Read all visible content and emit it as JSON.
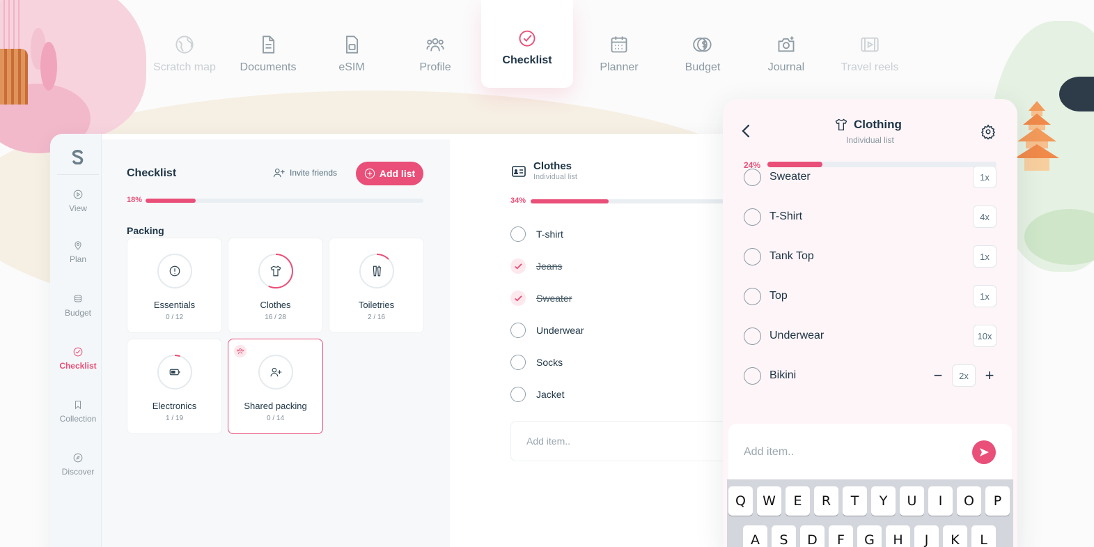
{
  "nav": {
    "tabs": [
      {
        "label": "Scratch map",
        "icon": "globe-icon",
        "state": "faded"
      },
      {
        "label": "Documents",
        "icon": "document-icon",
        "state": "normal"
      },
      {
        "label": "eSIM",
        "icon": "sim-card-icon",
        "state": "normal"
      },
      {
        "label": "Profile",
        "icon": "people-icon",
        "state": "normal"
      },
      {
        "label": "Checklist",
        "icon": "check-circle-icon",
        "state": "active"
      },
      {
        "label": "Planner",
        "icon": "calendar-icon",
        "state": "normal"
      },
      {
        "label": "Budget",
        "icon": "coins-icon",
        "state": "normal"
      },
      {
        "label": "Journal",
        "icon": "camera-plus-icon",
        "state": "normal"
      },
      {
        "label": "Travel reels",
        "icon": "video-icon",
        "state": "faded"
      }
    ]
  },
  "rail": {
    "items": [
      {
        "label": "View",
        "icon": "play-circle-icon"
      },
      {
        "label": "Plan",
        "icon": "map-pin-icon"
      },
      {
        "label": "Budget",
        "icon": "coin-stack-icon"
      },
      {
        "label": "Checklist",
        "icon": "check-circle-icon",
        "active": true
      },
      {
        "label": "Collection",
        "icon": "bookmark-icon"
      },
      {
        "label": "Discover",
        "icon": "compass-icon"
      }
    ]
  },
  "checklist": {
    "title": "Checklist",
    "invite_label": "Invite friends",
    "add_list_label": "Add list",
    "progress_label": "18%",
    "progress": 0.18,
    "section": "Packing",
    "lists": [
      {
        "name": "Essentials",
        "count": "0 / 12",
        "icon": "alert-icon",
        "progress": 0
      },
      {
        "name": "Clothes",
        "count": "16 / 28",
        "icon": "shirt-icon",
        "progress": 0.57
      },
      {
        "name": "Toiletries",
        "count": "2 / 16",
        "icon": "toiletries-icon",
        "progress": 0.125
      },
      {
        "name": "Electronics",
        "count": "1 / 19",
        "icon": "battery-icon",
        "progress": 0.05
      },
      {
        "name": "Shared packing",
        "count": "0 / 14",
        "icon": "add-user-icon",
        "progress": 0,
        "shared": true
      }
    ]
  },
  "clothes_list": {
    "title": "Clothes",
    "subtitle": "Individual list",
    "progress_label": "34%",
    "progress": 0.34,
    "items": [
      {
        "label": "T-shirt",
        "done": false
      },
      {
        "label": "Jeans",
        "done": true
      },
      {
        "label": "Sweater",
        "done": true
      },
      {
        "label": "Underwear",
        "done": false
      },
      {
        "label": "Socks",
        "done": false
      },
      {
        "label": "Jacket",
        "done": false
      }
    ],
    "add_placeholder": "Add item.."
  },
  "mobile": {
    "title": "Clothing",
    "subtitle": "Individual list",
    "progress_label": "24%",
    "progress": 0.24,
    "items": [
      {
        "label": "Sweater",
        "qty": "1x"
      },
      {
        "label": "T-Shirt",
        "qty": "4x"
      },
      {
        "label": "Tank Top",
        "qty": "1x"
      },
      {
        "label": "Top",
        "qty": "1x"
      },
      {
        "label": "Underwear",
        "qty": "10x"
      },
      {
        "label": "Bikini",
        "qty": "2x",
        "editing": true
      }
    ],
    "add_placeholder": "Add item..",
    "keyboard": {
      "row1": [
        "Q",
        "W",
        "E",
        "R",
        "T",
        "Y",
        "U",
        "I",
        "O",
        "P"
      ],
      "row2": [
        "A",
        "S",
        "D",
        "F",
        "G",
        "H",
        "J",
        "K",
        "L"
      ]
    }
  },
  "colors": {
    "accent": "#e94f78",
    "text": "#1d3445",
    "muted": "#8c9aa3"
  }
}
